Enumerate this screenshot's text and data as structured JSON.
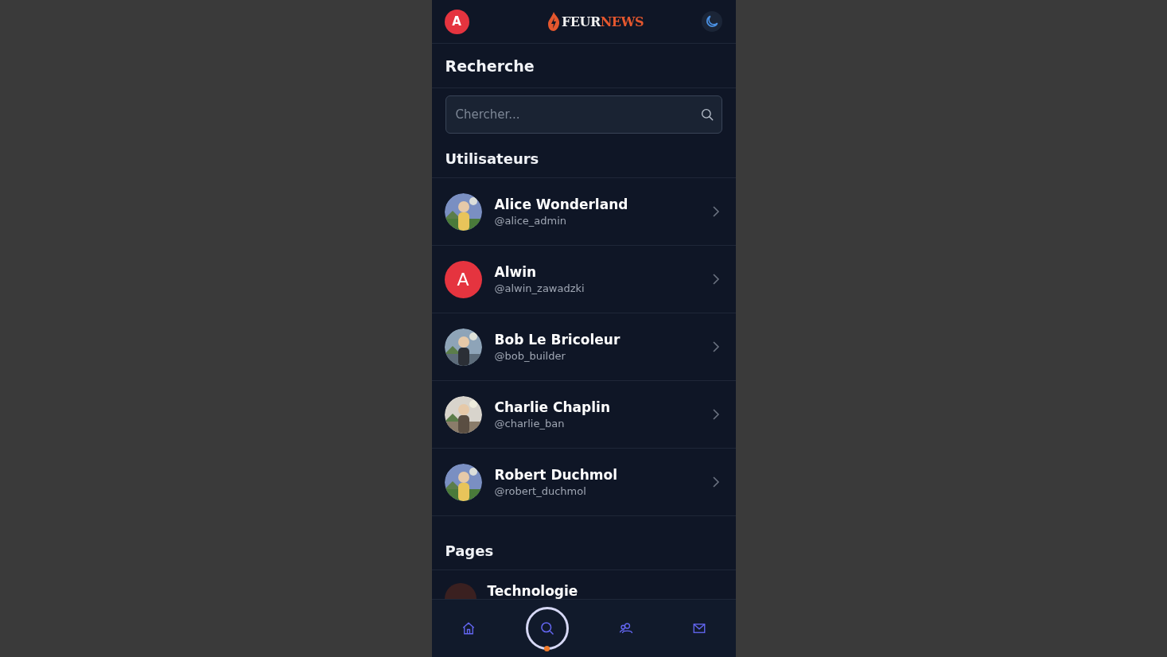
{
  "header": {
    "avatar_initial": "A",
    "logo": {
      "first": "FEUR",
      "second": "NEWS"
    }
  },
  "title": "Recherche",
  "search": {
    "placeholder": "Chercher..."
  },
  "users_heading": "Utilisateurs",
  "users": [
    {
      "name": "Alice Wonderland",
      "handle": "@alice_admin"
    },
    {
      "name": "Alwin",
      "handle": "@alwin_zawadzki",
      "avatar": {
        "kind": "initial",
        "initial": "A"
      }
    },
    {
      "name": "Bob Le Bricoleur",
      "handle": "@bob_builder"
    },
    {
      "name": "Charlie Chaplin",
      "handle": "@charlie_ban"
    },
    {
      "name": "Robert Duchmol",
      "handle": "@robert_duchmol"
    }
  ],
  "pages_heading": "Pages",
  "pages": [
    {
      "name": "Technologie"
    }
  ],
  "nav": [
    {
      "kind": "home",
      "selected": false
    },
    {
      "kind": "search",
      "selected": true
    },
    {
      "kind": "users",
      "selected": false
    },
    {
      "kind": "mail",
      "selected": false
    }
  ]
}
